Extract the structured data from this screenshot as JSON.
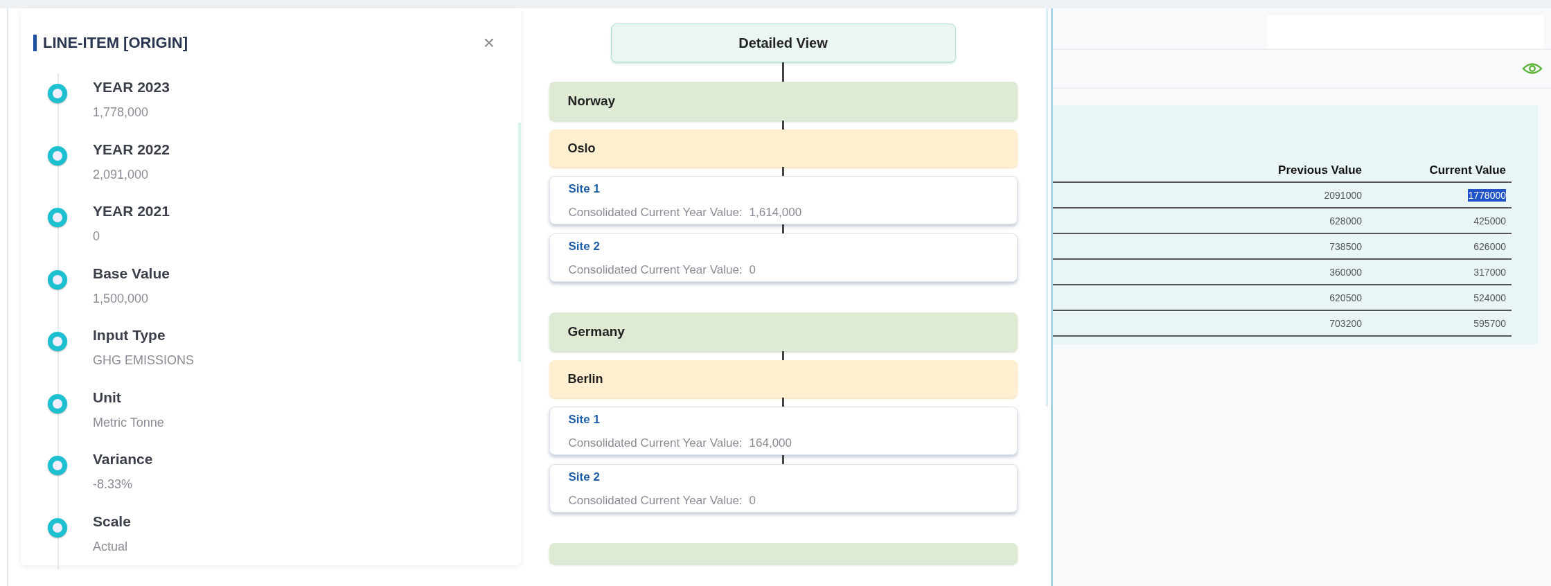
{
  "details_panel": {
    "title": "LINE-ITEM [ORIGIN]",
    "close": "×",
    "items": [
      {
        "label": "YEAR 2023",
        "value": "1,778,000"
      },
      {
        "label": "YEAR 2022",
        "value": "2,091,000"
      },
      {
        "label": "YEAR 2021",
        "value": "0"
      },
      {
        "label": "Base Value",
        "value": "1,500,000"
      },
      {
        "label": "Input Type",
        "value": "GHG EMISSIONS"
      },
      {
        "label": "Unit",
        "value": "Metric Tonne"
      },
      {
        "label": "Variance",
        "value": "-8.33%"
      },
      {
        "label": "Scale",
        "value": "Actual"
      }
    ]
  },
  "tree": {
    "title": "Detailed View",
    "more_below": true,
    "countries": [
      {
        "name": "Norway",
        "cities": [
          {
            "name": "Oslo",
            "sites": [
              {
                "name": "Site 1",
                "label": "Consolidated Current Year Value:",
                "value": "1,614,000"
              },
              {
                "name": "Site 2",
                "label": "Consolidated Current Year Value:",
                "value": "0"
              }
            ]
          }
        ]
      },
      {
        "name": "Germany",
        "cities": [
          {
            "name": "Berlin",
            "sites": [
              {
                "name": "Site 1",
                "label": "Consolidated Current Year Value:",
                "value": "164,000"
              },
              {
                "name": "Site 2",
                "label": "Consolidated Current Year Value:",
                "value": "0"
              }
            ]
          }
        ]
      }
    ]
  },
  "table": {
    "columns": [
      "Previous Value",
      "Current Value"
    ],
    "rows": [
      {
        "previous": "2091000",
        "current": "1778000",
        "selected": true
      },
      {
        "previous": "628000",
        "current": "425000",
        "selected": false
      },
      {
        "previous": "738500",
        "current": "626000",
        "selected": false
      },
      {
        "previous": "360000",
        "current": "317000",
        "selected": false
      },
      {
        "previous": "620500",
        "current": "524000",
        "selected": false
      },
      {
        "previous": "703200",
        "current": "595700",
        "selected": false
      }
    ]
  }
}
